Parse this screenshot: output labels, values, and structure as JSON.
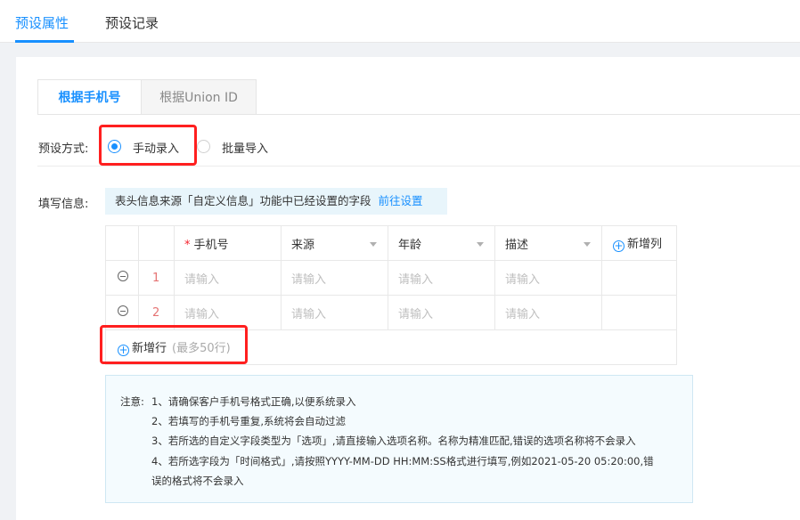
{
  "top_tabs": [
    {
      "label": "预设属性",
      "active": true
    },
    {
      "label": "预设记录",
      "active": false
    }
  ],
  "sub_tabs": [
    {
      "label": "根据手机号",
      "active": true
    },
    {
      "label": "根据Union ID",
      "active": false
    }
  ],
  "preset_method": {
    "label": "预设方式:",
    "options": [
      {
        "label": "手动录入",
        "selected": true
      },
      {
        "label": "批量导入",
        "selected": false
      }
    ]
  },
  "fill_info": {
    "label": "填写信息:",
    "hint": "表头信息来源「自定义信息」功能中已经设置的字段",
    "hint_link": "前往设置"
  },
  "table": {
    "columns": [
      {
        "label": "手机号",
        "required": true,
        "dropdown": false
      },
      {
        "label": "来源",
        "required": false,
        "dropdown": true
      },
      {
        "label": "年龄",
        "required": false,
        "dropdown": true
      },
      {
        "label": "描述",
        "required": false,
        "dropdown": true
      }
    ],
    "required_mark": "*",
    "add_column_label": "新增列",
    "rows": [
      {
        "index": "1",
        "placeholders": [
          "请输入",
          "请输入",
          "请输入",
          "请输入"
        ]
      },
      {
        "index": "2",
        "placeholders": [
          "请输入",
          "请输入",
          "请输入",
          "请输入"
        ]
      }
    ],
    "add_row_label": "新增行",
    "add_row_note": "(最多50行)"
  },
  "notice": {
    "prefix": "注意:",
    "lines": [
      "1、请确保客户手机号格式正确,以便系统录入",
      "2、若填写的手机号重复,系统将会自动过滤",
      "3、若所选的自定义字段类型为「选项」,请直接输入选项名称。名称为精准匹配,错误的选项名称将不会录入",
      "4、若所选字段为「时间格式」,请按照YYYY-MM-DD HH:MM:SS格式进行填写,例如2021-05-20 05:20:00,错",
      "误的格式将不会录入"
    ]
  },
  "colors": {
    "accent": "#1890ff",
    "highlight_box": "#ff1f1f",
    "hint_bg": "#e8f5fb",
    "notice_bg": "#f4fbfe"
  }
}
